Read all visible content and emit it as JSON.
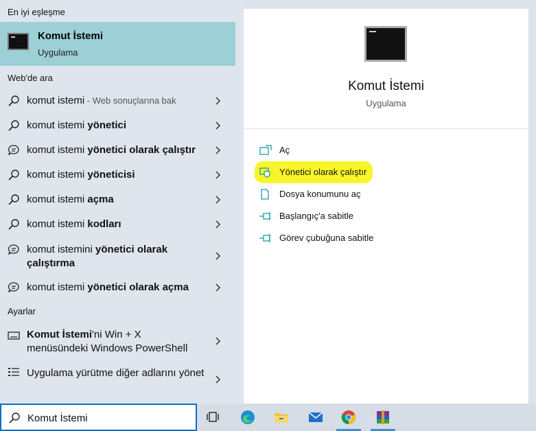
{
  "left": {
    "best_match_heading": "En iyi eşleşme",
    "best_match": {
      "title": "Komut İstemi",
      "subtitle": "Uygulama"
    },
    "web_heading": "Web'de ara",
    "web_results": [
      {
        "prefix": "komut istemi",
        "bold": "",
        "suffix": " - Web sonuçlarına bak",
        "icon": "search-icon"
      },
      {
        "prefix": "komut istemi ",
        "bold": "yönetici",
        "suffix": "",
        "icon": "search-icon"
      },
      {
        "prefix": "komut istemi ",
        "bold": "yönetici olarak çalıştır",
        "suffix": "",
        "icon": "chat-icon"
      },
      {
        "prefix": "komut istemi ",
        "bold": "yöneticisi",
        "suffix": "",
        "icon": "search-icon"
      },
      {
        "prefix": "komut istemi ",
        "bold": "açma",
        "suffix": "",
        "icon": "search-icon"
      },
      {
        "prefix": "komut istemi ",
        "bold": "kodları",
        "suffix": "",
        "icon": "search-icon"
      },
      {
        "prefix": "komut istemini",
        "bold": " yönetici olarak çalıştırma",
        "suffix": "",
        "icon": "chat-icon"
      },
      {
        "prefix": "komut istemi ",
        "bold": "yönetici olarak açma",
        "suffix": "",
        "icon": "chat-icon"
      }
    ],
    "settings_heading": "Ayarlar",
    "settings": [
      {
        "bold": "Komut İstemi",
        "rest": "'ni Win + X menüsündeki Windows PowerShell",
        "icon": "keyboard-icon"
      },
      {
        "bold": "",
        "rest": "Uygulama yürütme diğer adlarını yönet",
        "icon": "list-icon"
      }
    ]
  },
  "right": {
    "title": "Komut İstemi",
    "subtitle": "Uygulama",
    "actions": [
      {
        "label": "Aç",
        "icon": "open-icon"
      },
      {
        "label": "Yönetici olarak çalıştır",
        "icon": "shield-icon"
      },
      {
        "label": "Dosya konumunu aç",
        "icon": "file-location-icon"
      },
      {
        "label": "Başlangıç'a sabitle",
        "icon": "pin-icon"
      },
      {
        "label": "Görev çubuğuna sabitle",
        "icon": "pin-icon"
      }
    ],
    "highlight_color": "#f9f52b"
  },
  "taskbar": {
    "search_value": "Komut İstemi",
    "apps": [
      "task-view",
      "edge",
      "file-explorer",
      "mail",
      "chrome",
      "winrar"
    ]
  },
  "colors": {
    "accent": "#0b6fc6",
    "best_match_bg": "#9ccfd6",
    "icon_teal": "#1a9ca6"
  }
}
